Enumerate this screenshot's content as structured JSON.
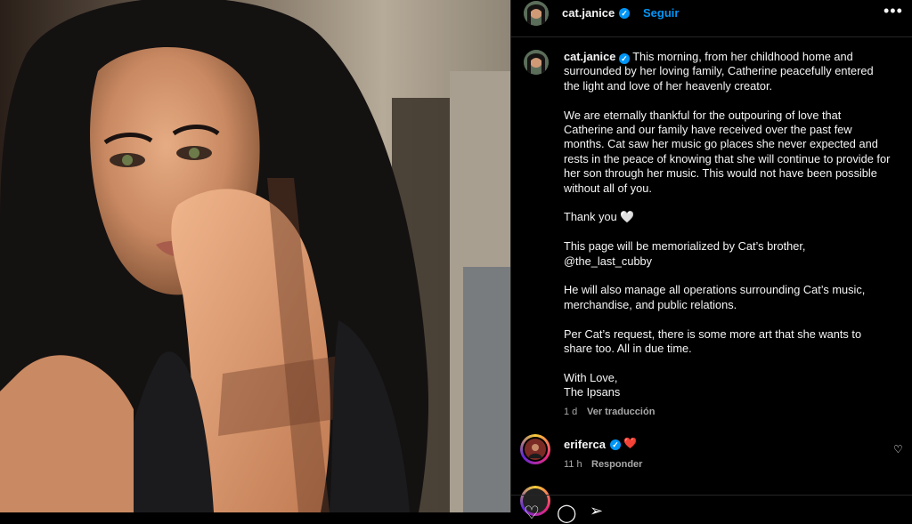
{
  "post": {
    "author": "cat.janice",
    "follow_label": "Seguir",
    "more_label": "•••",
    "caption_user": "cat.janice",
    "caption_paragraphs": [
      "This morning, from her childhood home and surrounded by her loving family, Catherine peacefully entered the light and love of her heavenly creator.",
      "We are eternally thankful for the outpouring of love that Catherine and our family have received over the past few months. Cat saw her music go places she never expected and rests in the peace of knowing that she will continue to provide for her son through her music. This would not have been possible without all of you.",
      "Thank you 🤍",
      "This page will be memorialized by Cat’s brother,\n@the_last_cubby",
      "He will also manage all operations surrounding Cat’s music, merchandise, and public relations.",
      "Per Cat’s request, there is some more art that she wants to share too. All in due time.",
      "With Love,\nThe Ipsans"
    ],
    "caption_time": "1 d",
    "translate_label": "Ver traducción"
  },
  "comments": [
    {
      "user": "eriferca",
      "text": "❤️",
      "time": "11 h",
      "reply_label": "Responder"
    }
  ],
  "icons": {
    "verified": "verified-badge-icon",
    "like": "heart-icon",
    "comment": "comment-icon",
    "share": "share-icon"
  },
  "colors": {
    "accent": "#0095f6",
    "background": "#000000",
    "muted_text": "#a8a8a8",
    "heart_red": "#ed2a3f"
  }
}
